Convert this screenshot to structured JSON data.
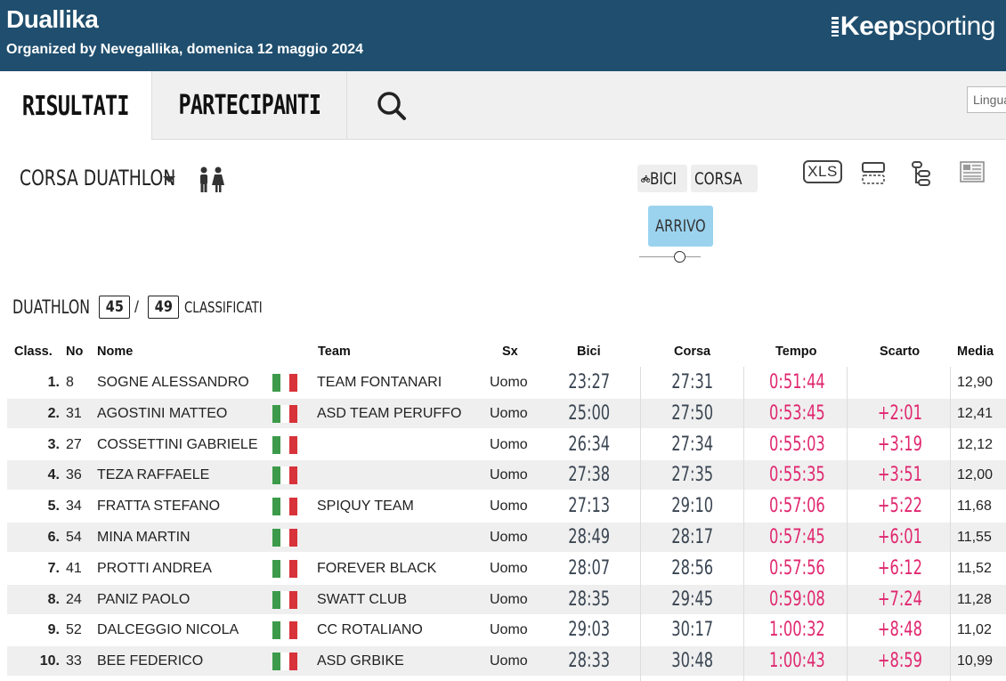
{
  "header": {
    "title": "Duallika",
    "subtitle": "Organized by Nevegallika, domenica 12 maggio 2024",
    "logo_prefix": "Keep",
    "logo_suffix": "sporting"
  },
  "tabs": [
    {
      "label": "RISULTATI",
      "active": true
    },
    {
      "label": "PARTECIPANTI",
      "active": false
    }
  ],
  "language_select": {
    "value": "Lingua"
  },
  "race": {
    "label": "CORSA  DUATHLON",
    "gender_icon": "couple-icon"
  },
  "splits": [
    {
      "label": "BICI",
      "icon": "bike-icon"
    },
    {
      "label": "CORSA",
      "icon": "runner-icon"
    }
  ],
  "tools": [
    {
      "label": "XLS",
      "icon": "xls-icon"
    },
    {
      "icon": "cards-view-icon"
    },
    {
      "icon": "tree-view-icon"
    },
    {
      "icon": "newspaper-icon"
    }
  ],
  "checkpoint": {
    "label": "ARRIVO",
    "slider_position": 0.67
  },
  "count": {
    "race": "DUATHLON",
    "classified": "45",
    "total": "49",
    "label": "CLASSIFICATI"
  },
  "table": {
    "columns": [
      "Class.",
      "No",
      "Nome",
      "Team",
      "Sx",
      "Bici",
      "Corsa",
      "Tempo",
      "Scarto",
      "Media"
    ],
    "rows": [
      {
        "class": "1.",
        "no": "8",
        "nome": "SOGNE ALESSANDRO",
        "team": "TEAM FONTANARI",
        "sx": "Uomo",
        "bici": "23:27",
        "corsa": "27:31",
        "tempo": "0:51:44",
        "scarto": "",
        "media": "12,90"
      },
      {
        "class": "2.",
        "no": "31",
        "nome": "AGOSTINI MATTEO",
        "team": "ASD TEAM PERUFFO",
        "sx": "Uomo",
        "bici": "25:00",
        "corsa": "27:50",
        "tempo": "0:53:45",
        "scarto": "+2:01",
        "media": "12,41"
      },
      {
        "class": "3.",
        "no": "27",
        "nome": "COSSETTINI GABRIELE",
        "team": "",
        "sx": "Uomo",
        "bici": "26:34",
        "corsa": "27:34",
        "tempo": "0:55:03",
        "scarto": "+3:19",
        "media": "12,12"
      },
      {
        "class": "4.",
        "no": "36",
        "nome": "TEZA RAFFAELE",
        "team": "",
        "sx": "Uomo",
        "bici": "27:38",
        "corsa": "27:35",
        "tempo": "0:55:35",
        "scarto": "+3:51",
        "media": "12,00"
      },
      {
        "class": "5.",
        "no": "34",
        "nome": "FRATTA STEFANO",
        "team": "SPIQUY TEAM",
        "sx": "Uomo",
        "bici": "27:13",
        "corsa": "29:10",
        "tempo": "0:57:06",
        "scarto": "+5:22",
        "media": "11,68"
      },
      {
        "class": "6.",
        "no": "54",
        "nome": "MINA MARTIN",
        "team": "",
        "sx": "Uomo",
        "bici": "28:49",
        "corsa": "28:17",
        "tempo": "0:57:45",
        "scarto": "+6:01",
        "media": "11,55"
      },
      {
        "class": "7.",
        "no": "41",
        "nome": "PROTTI ANDREA",
        "team": "FOREVER BLACK",
        "sx": "Uomo",
        "bici": "28:07",
        "corsa": "28:56",
        "tempo": "0:57:56",
        "scarto": "+6:12",
        "media": "11,52"
      },
      {
        "class": "8.",
        "no": "24",
        "nome": "PANIZ PAOLO",
        "team": "SWATT CLUB",
        "sx": "Uomo",
        "bici": "28:35",
        "corsa": "29:45",
        "tempo": "0:59:08",
        "scarto": "+7:24",
        "media": "11,28"
      },
      {
        "class": "9.",
        "no": "52",
        "nome": "DALCEGGIO NICOLA",
        "team": "CC ROTALIANO",
        "sx": "Uomo",
        "bici": "29:03",
        "corsa": "30:17",
        "tempo": "1:00:32",
        "scarto": "+8:48",
        "media": "11,02"
      },
      {
        "class": "10.",
        "no": "33",
        "nome": "BEE FEDERICO",
        "team": "ASD GRBIKE",
        "sx": "Uomo",
        "bici": "28:33",
        "corsa": "30:48",
        "tempo": "1:00:43",
        "scarto": "+8:59",
        "media": "10,99"
      }
    ]
  },
  "colors": {
    "header_bg": "#1f4e6e",
    "time_accent": "#e0276f",
    "checkpoint_bg": "#9bd3ef",
    "flag_green": "#3c9a4a",
    "flag_white": "#ffffff",
    "flag_red": "#d8323a"
  }
}
